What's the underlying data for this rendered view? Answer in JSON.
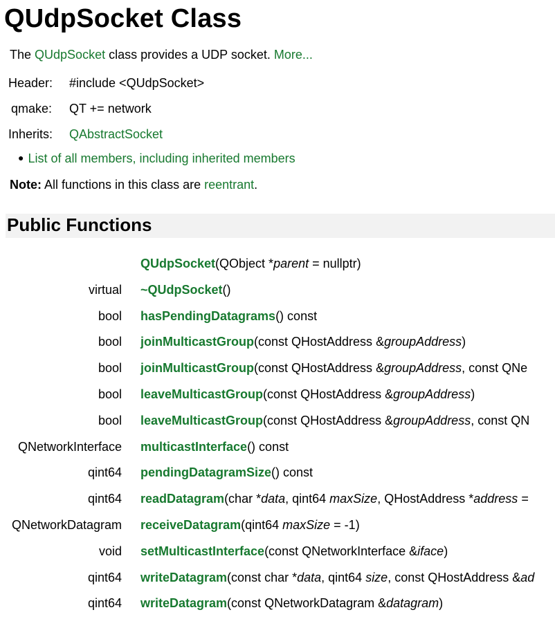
{
  "page_title": "QUdpSocket Class",
  "brief": {
    "prefix": "The ",
    "class_link": "QUdpSocket",
    "middle": " class provides a UDP socket. ",
    "more_link": "More..."
  },
  "meta": {
    "header_label": "Header:",
    "header_value": "#include <QUdpSocket>",
    "qmake_label": "qmake:",
    "qmake_value": "QT += network",
    "inherits_label": "Inherits:",
    "inherits_value": "QAbstractSocket"
  },
  "members_link": "List of all members, including inherited members",
  "note": {
    "label": "Note:",
    "text": " All functions in this class are ",
    "link": "reentrant",
    "suffix": "."
  },
  "section_title": "Public Functions",
  "functions": [
    {
      "type": "",
      "name": "QUdpSocket",
      "sig": [
        [
          "(QObject *",
          ""
        ],
        [
          "parent",
          "i"
        ],
        [
          " = nullptr)",
          ""
        ]
      ]
    },
    {
      "type": "virtual",
      "name": "~QUdpSocket",
      "sig": [
        [
          "()",
          ""
        ]
      ]
    },
    {
      "type": "bool",
      "name": "hasPendingDatagrams",
      "sig": [
        [
          "() const",
          ""
        ]
      ]
    },
    {
      "type": "bool",
      "name": "joinMulticastGroup",
      "sig": [
        [
          "(const QHostAddress &",
          ""
        ],
        [
          "groupAddress",
          "i"
        ],
        [
          ")",
          ""
        ]
      ]
    },
    {
      "type": "bool",
      "name": "joinMulticastGroup",
      "sig": [
        [
          "(const QHostAddress &",
          ""
        ],
        [
          "groupAddress",
          "i"
        ],
        [
          ", const QNe",
          ""
        ]
      ]
    },
    {
      "type": "bool",
      "name": "leaveMulticastGroup",
      "sig": [
        [
          "(const QHostAddress &",
          ""
        ],
        [
          "groupAddress",
          "i"
        ],
        [
          ")",
          ""
        ]
      ]
    },
    {
      "type": "bool",
      "name": "leaveMulticastGroup",
      "sig": [
        [
          "(const QHostAddress &",
          ""
        ],
        [
          "groupAddress",
          "i"
        ],
        [
          ", const QN",
          ""
        ]
      ]
    },
    {
      "type": "QNetworkInterface",
      "name": "multicastInterface",
      "sig": [
        [
          "() const",
          ""
        ]
      ]
    },
    {
      "type": "qint64",
      "name": "pendingDatagramSize",
      "sig": [
        [
          "() const",
          ""
        ]
      ]
    },
    {
      "type": "qint64",
      "name": "readDatagram",
      "sig": [
        [
          "(char *",
          ""
        ],
        [
          "data",
          "i"
        ],
        [
          ", qint64 ",
          ""
        ],
        [
          "maxSize",
          "i"
        ],
        [
          ", QHostAddress *",
          ""
        ],
        [
          "address",
          "i"
        ],
        [
          " =",
          ""
        ]
      ]
    },
    {
      "type": "QNetworkDatagram",
      "name": "receiveDatagram",
      "sig": [
        [
          "(qint64 ",
          ""
        ],
        [
          "maxSize",
          "i"
        ],
        [
          " = -1)",
          ""
        ]
      ]
    },
    {
      "type": "void",
      "name": "setMulticastInterface",
      "sig": [
        [
          "(const QNetworkInterface &",
          ""
        ],
        [
          "iface",
          "i"
        ],
        [
          ")",
          ""
        ]
      ]
    },
    {
      "type": "qint64",
      "name": "writeDatagram",
      "sig": [
        [
          "(const char *",
          ""
        ],
        [
          "data",
          "i"
        ],
        [
          ", qint64 ",
          ""
        ],
        [
          "size",
          "i"
        ],
        [
          ", const QHostAddress &",
          ""
        ],
        [
          "ad",
          "i"
        ]
      ]
    },
    {
      "type": "qint64",
      "name": "writeDatagram",
      "sig": [
        [
          "(const QNetworkDatagram &",
          ""
        ],
        [
          "datagram",
          "i"
        ],
        [
          ")",
          ""
        ]
      ]
    }
  ],
  "colors": {
    "link": "#17792f",
    "section_bg": "#f2f2f2"
  }
}
